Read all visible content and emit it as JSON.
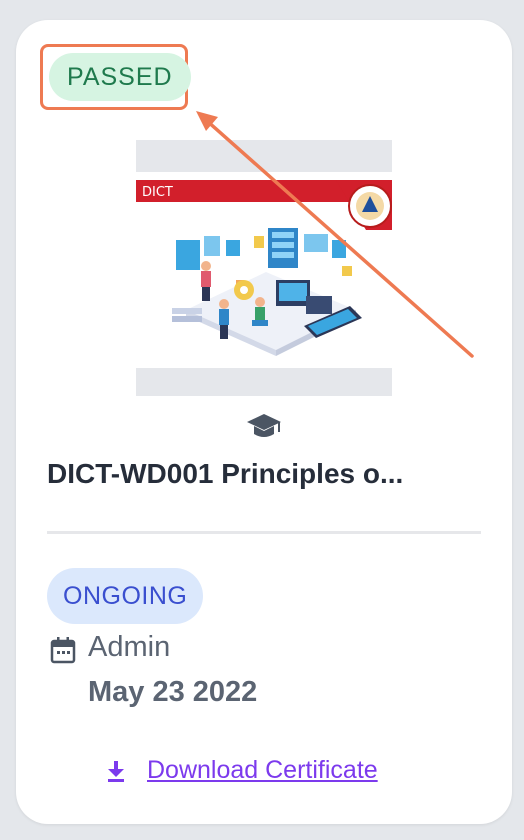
{
  "card": {
    "status_badge": "PASSED",
    "thumbnail": {
      "banner_text": "DICT"
    },
    "course_icon": "graduation-cap-icon",
    "title": "DICT-WD001 Principles o...",
    "progress_badge": "ONGOING",
    "author_icon": "calendar-icon",
    "author": "Admin",
    "date": "May 23 2022",
    "download": {
      "icon": "download-icon",
      "label": "Download Certificate"
    }
  },
  "colors": {
    "passed_bg": "#d6f4e2",
    "passed_text": "#1f7a4d",
    "ongoing_bg": "#dbe8fc",
    "ongoing_text": "#3a4fcf",
    "link": "#7c3aed",
    "annotation": "#ee7a52"
  }
}
